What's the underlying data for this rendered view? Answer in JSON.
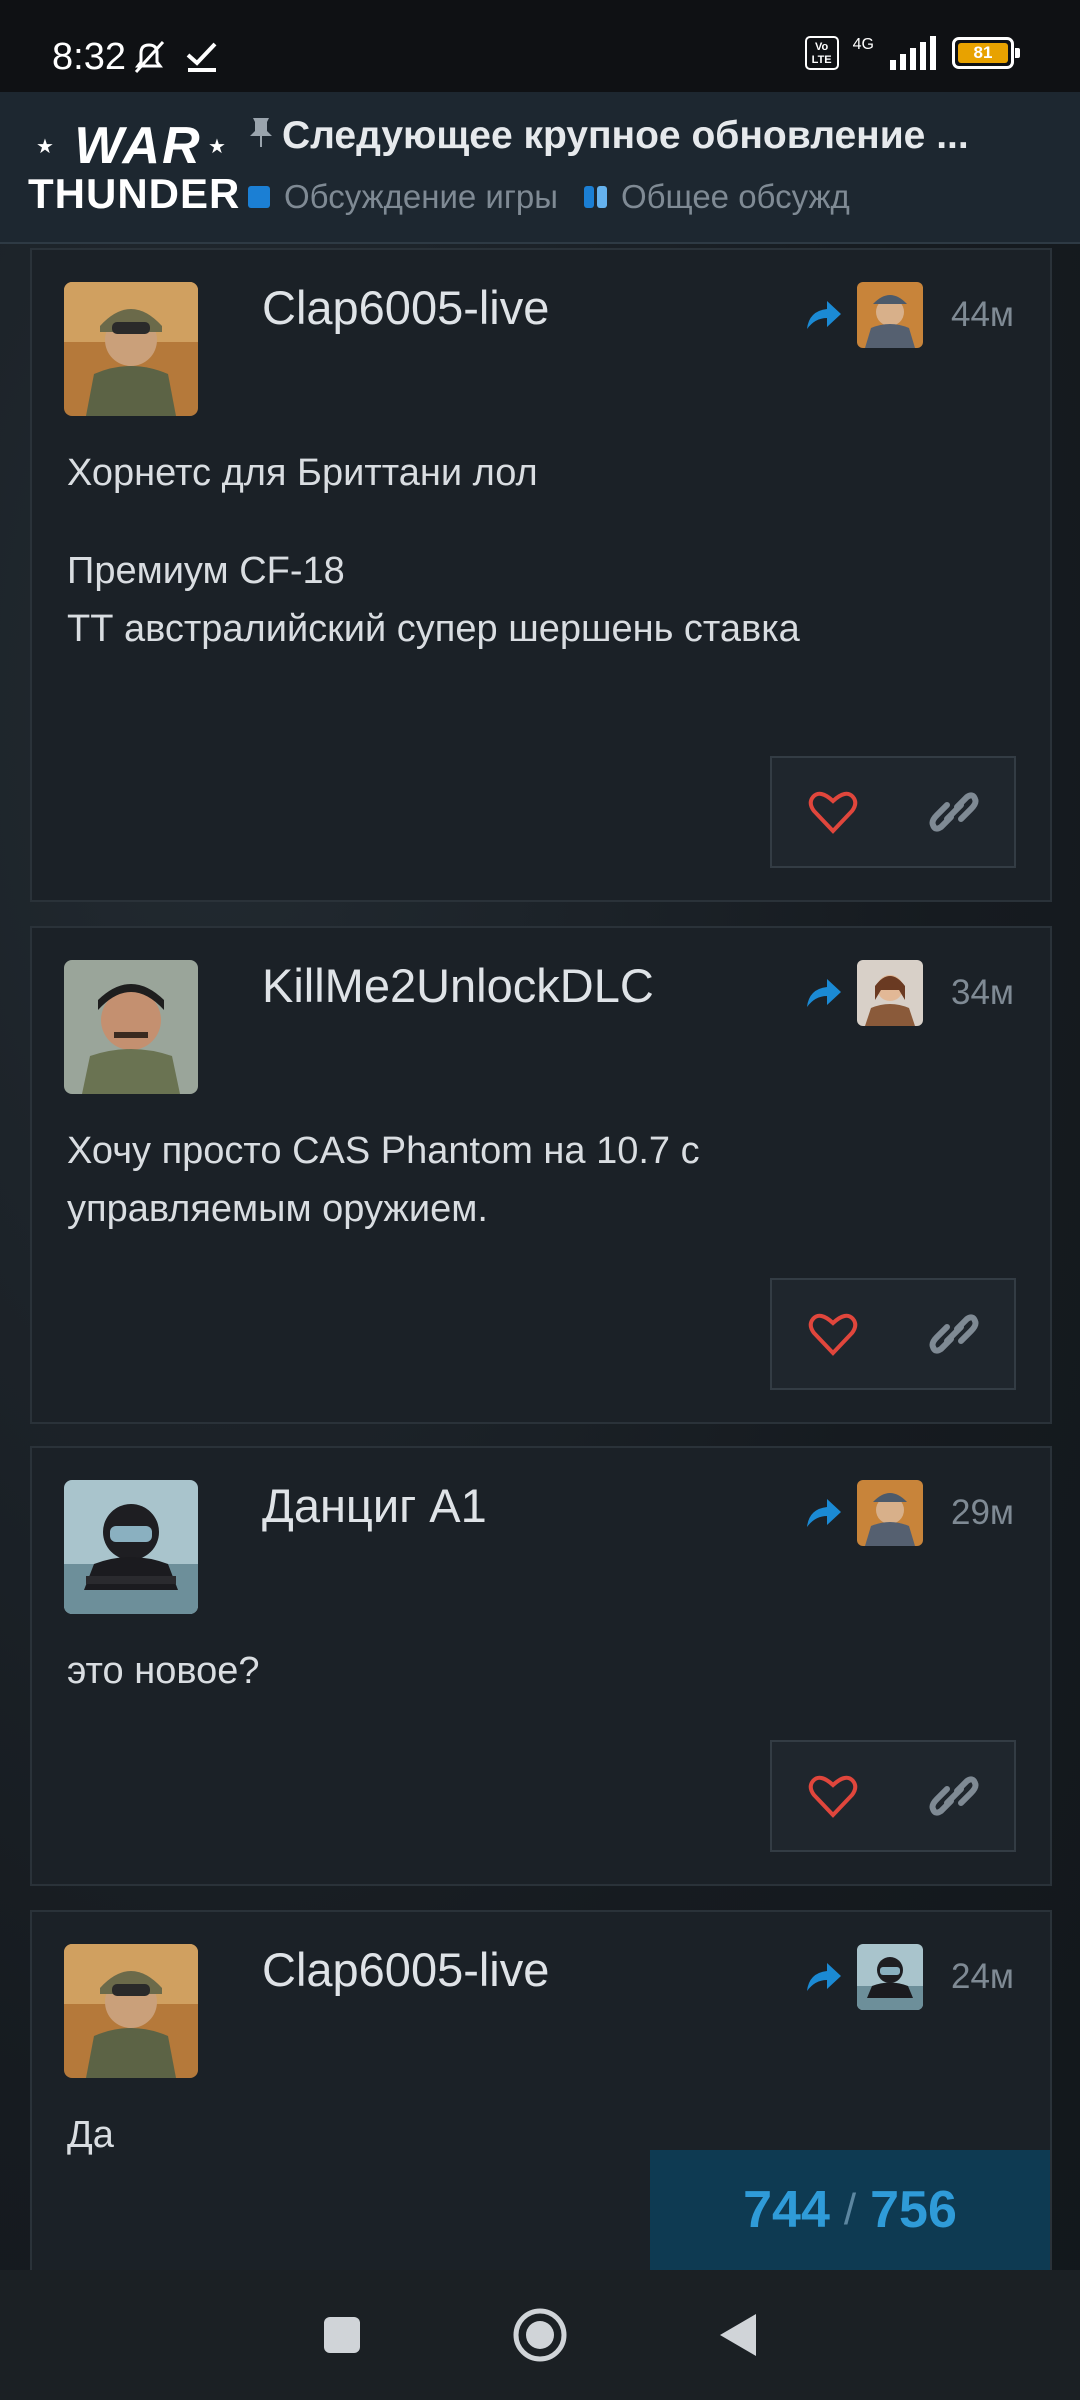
{
  "status_bar": {
    "time": "8:32",
    "network": "4G",
    "volte": "Vo LTE",
    "battery": "81"
  },
  "header": {
    "logo_line1": "WAR",
    "logo_line2": "THUNDER",
    "topic_title": "Следующее крупное обновление ...",
    "categories": [
      "Обсуждение игры",
      "Общее обсужд"
    ]
  },
  "posts": [
    {
      "username": "Clap6005-live",
      "time": "44м",
      "body": [
        "Хорнетс для Бриттани лол",
        "Премиум CF-18\nТТ австралийский супер шершень ставка"
      ]
    },
    {
      "username": "KillMe2UnlockDLC",
      "time": "34м",
      "body": [
        "Хочу просто CAS Phantom на 10.7 с управляемым оружием."
      ]
    },
    {
      "username": "Данциг A1",
      "time": "29м",
      "body": [
        "это новое?"
      ]
    },
    {
      "username": "Clap6005-live",
      "time": "24м",
      "body": [
        "Да"
      ]
    }
  ],
  "progress": {
    "current": "744",
    "total": "756"
  },
  "colors": {
    "accent": "#1b7fd4",
    "heart": "#e0463c",
    "background": "#1b2127"
  }
}
